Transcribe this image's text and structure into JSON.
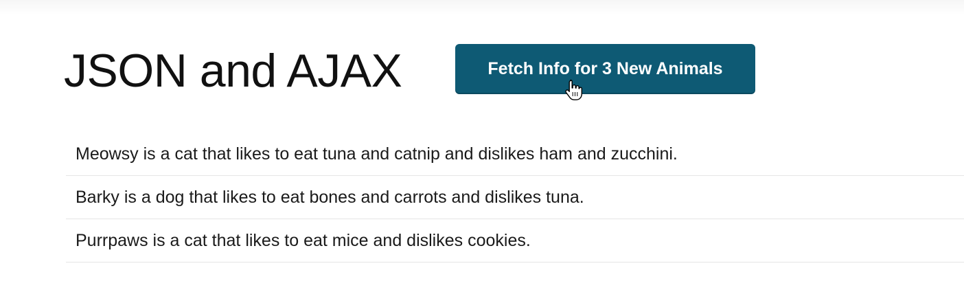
{
  "page": {
    "title": "JSON and AJAX"
  },
  "button": {
    "label": "Fetch Info for 3 New Animals",
    "color": "#0e5a74"
  },
  "cursor": {
    "icon": "hand-pointer-icon"
  },
  "animals": [
    {
      "text": "Meowsy is a cat that likes to eat tuna and catnip and dislikes ham and zucchini."
    },
    {
      "text": "Barky is a dog that likes to eat bones and carrots and dislikes tuna."
    },
    {
      "text": "Purrpaws is a cat that likes to eat mice and dislikes cookies."
    }
  ]
}
